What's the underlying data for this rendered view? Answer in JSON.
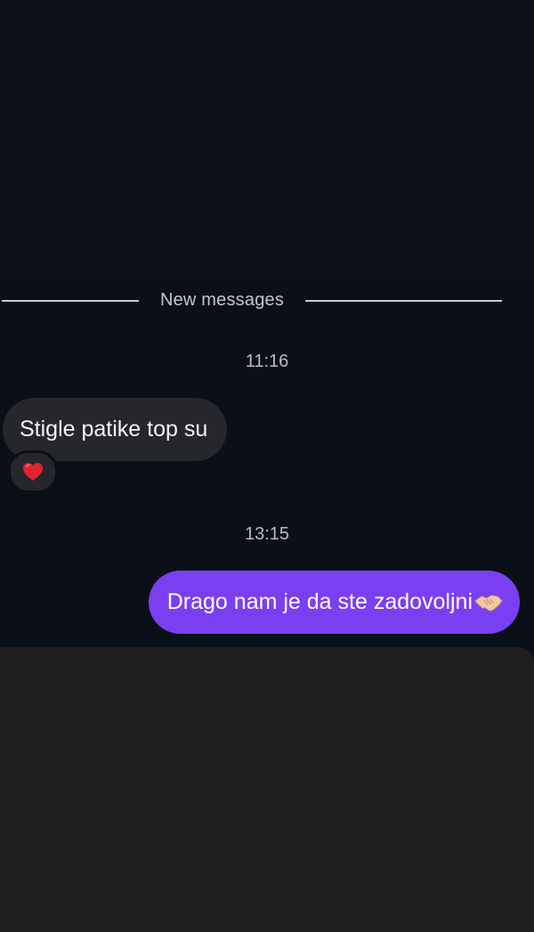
{
  "chat": {
    "divider_label": "New messages",
    "messages": [
      {
        "time": "11:16",
        "direction": "incoming",
        "text": "Stigle patike top su",
        "reaction": "red-heart-icon"
      },
      {
        "time": "13:15",
        "direction": "outgoing",
        "text": "Drago nam je da ste zadovoljni",
        "trailing_emoji": "handshake-icon"
      }
    ]
  },
  "colors": {
    "background": "#0b0f17",
    "incoming_bubble": "#25272c",
    "outgoing_bubble": "#7b3ff2",
    "bottom_panel": "#1e1e1f"
  }
}
